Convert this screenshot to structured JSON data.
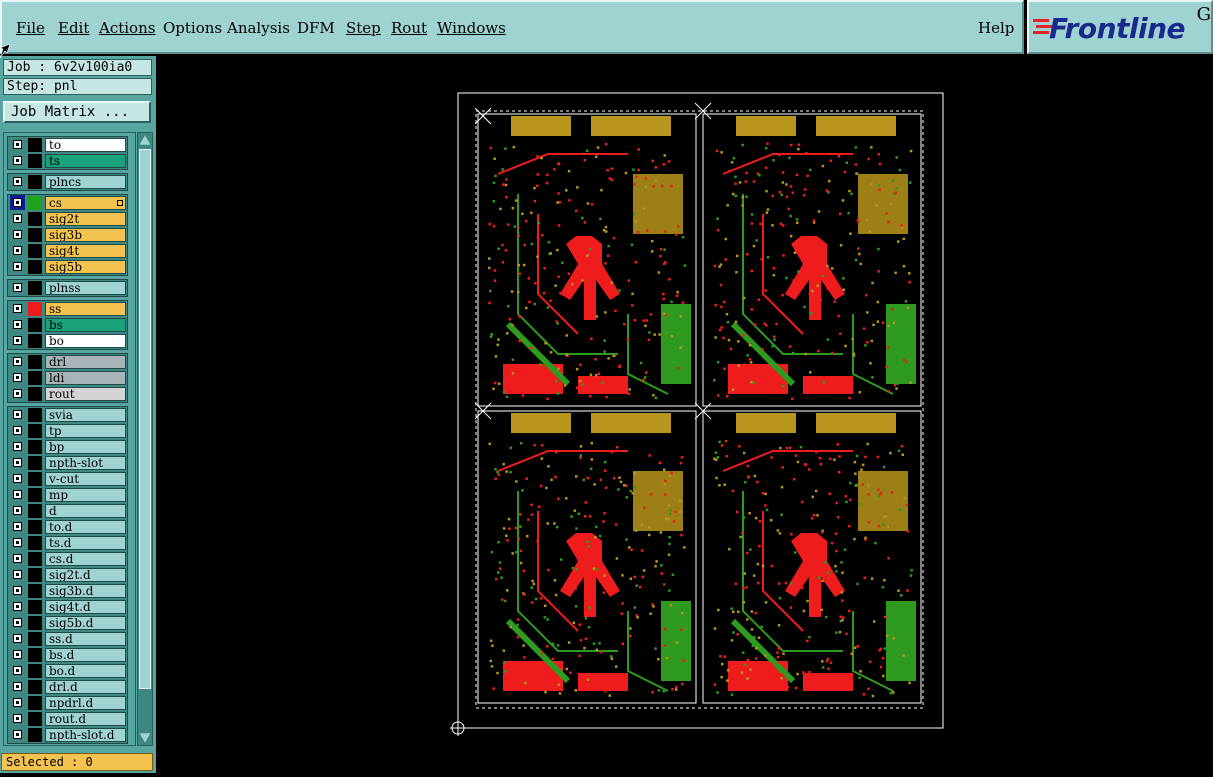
{
  "menu": {
    "items": [
      {
        "label": "File",
        "mnemonic_underlined": true
      },
      {
        "label": "Edit",
        "mnemonic_underlined": true
      },
      {
        "label": "Actions",
        "mnemonic_underlined": true
      },
      {
        "label": "Options",
        "mnemonic_underlined": false
      },
      {
        "label": "Analysis",
        "mnemonic_underlined": false
      },
      {
        "label": "DFM",
        "mnemonic_underlined": false
      },
      {
        "label": "Step",
        "mnemonic_underlined": true
      },
      {
        "label": "Rout",
        "mnemonic_underlined": true
      },
      {
        "label": "Windows",
        "mnemonic_underlined": true
      }
    ],
    "help": "Help"
  },
  "logo": {
    "text": "Frontline",
    "suffix": "G",
    "color": "#1a2a8c",
    "accent": "#e8202a"
  },
  "job_info": {
    "job": "Job : 6v2v100ia0",
    "step": "Step: pnl"
  },
  "matrix_button": "Job Matrix ...",
  "layers": {
    "groups": [
      {
        "rows": [
          {
            "name": "to",
            "color": "#ffffff",
            "swatch": "#000000"
          },
          {
            "name": "ts",
            "color": "#1aa37a",
            "swatch": "#000000"
          }
        ]
      },
      {
        "rows": [
          {
            "name": "plncs",
            "color": "#9fd3d1",
            "swatch": "#000000"
          }
        ]
      },
      {
        "rows": [
          {
            "name": "cs",
            "color": "#f4c24f",
            "swatch": "#1fa31f",
            "selected": true
          },
          {
            "name": "sig2t",
            "color": "#f4c24f",
            "swatch": "#000000"
          },
          {
            "name": "sig3b",
            "color": "#f4c24f",
            "swatch": "#000000"
          },
          {
            "name": "sig4t",
            "color": "#f4c24f",
            "swatch": "#000000"
          },
          {
            "name": "sig5b",
            "color": "#f4c24f",
            "swatch": "#000000"
          }
        ]
      },
      {
        "rows": [
          {
            "name": "plnss",
            "color": "#9fd3d1",
            "swatch": "#000000"
          }
        ]
      },
      {
        "rows": [
          {
            "name": "ss",
            "color": "#f4c24f",
            "swatch": "#ee1c1c"
          },
          {
            "name": "bs",
            "color": "#1aa37a",
            "swatch": "#000000"
          },
          {
            "name": "bo",
            "color": "#ffffff",
            "swatch": "#000000"
          }
        ]
      },
      {
        "rows": [
          {
            "name": "drl",
            "color": "#a8b4b8",
            "swatch": "#000000"
          },
          {
            "name": "ldi",
            "color": "#a8b4b8",
            "swatch": "#000000"
          },
          {
            "name": "rout",
            "color": "#d4d4d4",
            "swatch": "#000000"
          }
        ]
      },
      {
        "rows": [
          {
            "name": "svia",
            "color": "#9fd3d1",
            "swatch": "#000000"
          },
          {
            "name": "tp",
            "color": "#9fd3d1",
            "swatch": "#000000"
          },
          {
            "name": "bp",
            "color": "#9fd3d1",
            "swatch": "#000000"
          },
          {
            "name": "npth-slot",
            "color": "#9fd3d1",
            "swatch": "#000000"
          },
          {
            "name": "v-cut",
            "color": "#9fd3d1",
            "swatch": "#000000"
          },
          {
            "name": "mp",
            "color": "#9fd3d1",
            "swatch": "#000000"
          },
          {
            "name": "d",
            "color": "#9fd3d1",
            "swatch": "#000000"
          },
          {
            "name": "to.d",
            "color": "#9fd3d1",
            "swatch": "#000000"
          },
          {
            "name": "ts.d",
            "color": "#9fd3d1",
            "swatch": "#000000"
          },
          {
            "name": "cs.d",
            "color": "#9fd3d1",
            "swatch": "#000000"
          },
          {
            "name": "sig2t.d",
            "color": "#9fd3d1",
            "swatch": "#000000"
          },
          {
            "name": "sig3b.d",
            "color": "#9fd3d1",
            "swatch": "#000000"
          },
          {
            "name": "sig4t.d",
            "color": "#9fd3d1",
            "swatch": "#000000"
          },
          {
            "name": "sig5b.d",
            "color": "#9fd3d1",
            "swatch": "#000000"
          },
          {
            "name": "ss.d",
            "color": "#9fd3d1",
            "swatch": "#000000"
          },
          {
            "name": "bs.d",
            "color": "#9fd3d1",
            "swatch": "#000000"
          },
          {
            "name": "bo.d",
            "color": "#9fd3d1",
            "swatch": "#000000"
          },
          {
            "name": "drl.d",
            "color": "#9fd3d1",
            "swatch": "#000000"
          },
          {
            "name": "npdrl.d",
            "color": "#9fd3d1",
            "swatch": "#000000"
          },
          {
            "name": "rout.d",
            "color": "#9fd3d1",
            "swatch": "#000000"
          },
          {
            "name": "npth-slot.d",
            "color": "#9fd3d1",
            "swatch": "#000000"
          }
        ]
      }
    ]
  },
  "status": {
    "selected": "Selected : 0"
  },
  "colors": {
    "panel": "#57a6a1",
    "menubar": "#9fd3d1",
    "trace_red": "#ee1c1c",
    "trace_green": "#2e9a1f",
    "copper_gold": "#b8951c"
  }
}
